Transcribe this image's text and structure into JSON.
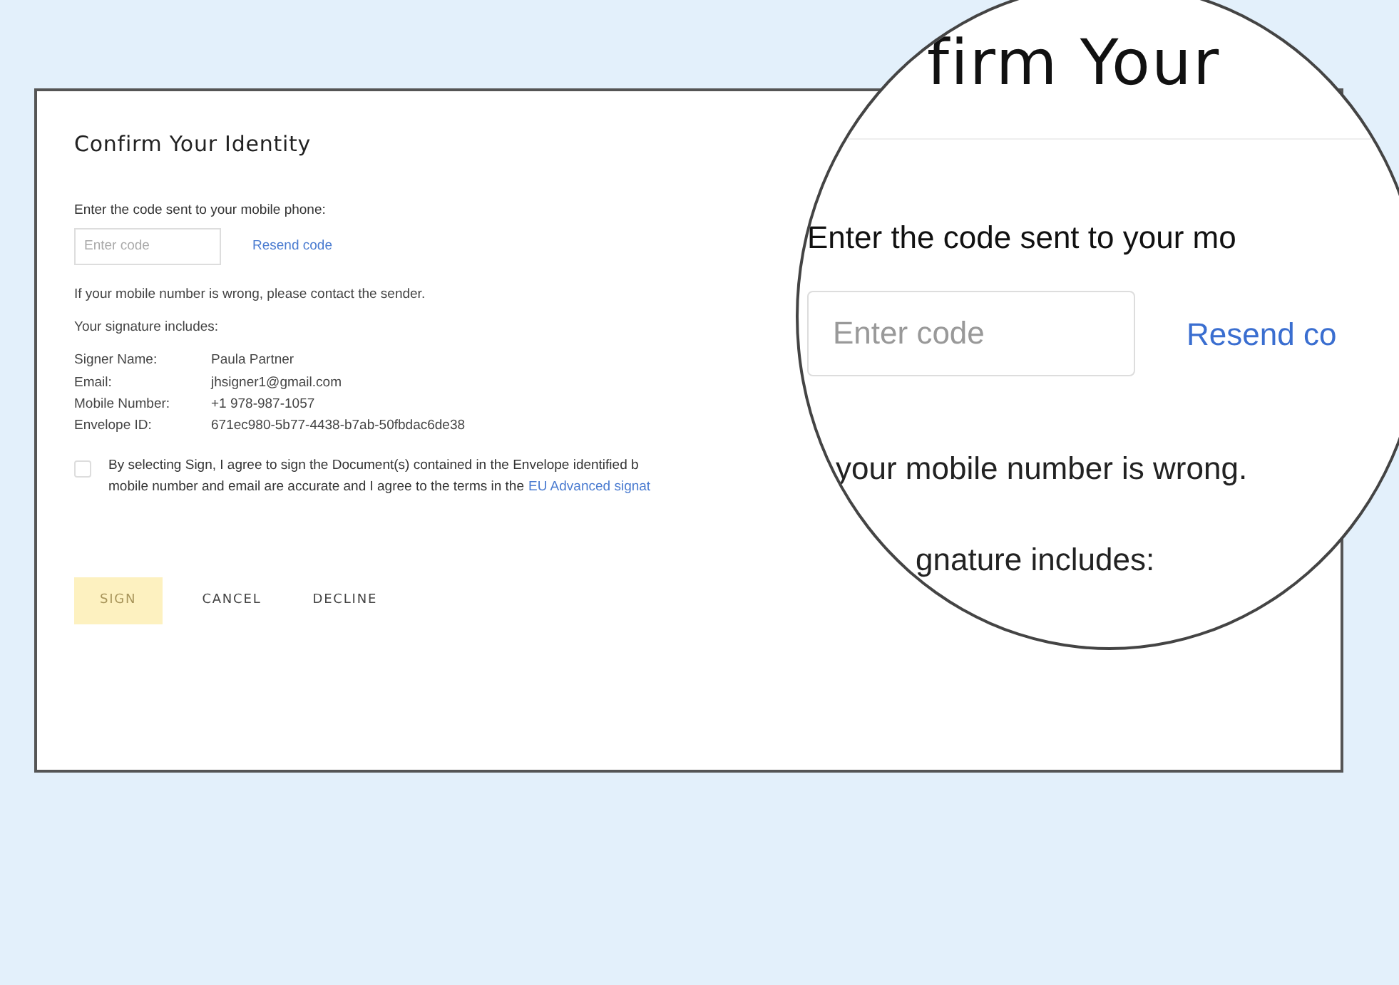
{
  "dialog": {
    "title": "Confirm Your Identity",
    "code_prompt": "Enter the code sent to your mobile phone:",
    "code_field": {
      "placeholder": "Enter code"
    },
    "resend_link": "Resend code",
    "wrong_number_note": "If your mobile number is wrong, please contact the sender.",
    "signature_heading": "Your signature includes:",
    "details": [
      {
        "label": "Signer Name:",
        "value": "Paula Partner"
      },
      {
        "label": "Email:",
        "value": "jhsigner1@gmail.com"
      },
      {
        "label": "Mobile Number:",
        "value": "+1 978-987-1057"
      },
      {
        "label": "Envelope ID:",
        "value": "671ec980-5b77-4438-b7ab-50fbdac6de38"
      }
    ],
    "consent": {
      "checked": false,
      "line_1": "By selecting Sign, I agree to sign the Document(s) contained in the Envelope identified b",
      "line_2": "mobile number and email are accurate and I agree to the terms in the",
      "link": "EU Advanced signat"
    },
    "buttons": [
      {
        "label": "SIGN",
        "disabled": true,
        "kind": "primary"
      },
      {
        "label": "CANCEL",
        "disabled": false,
        "kind": "text"
      },
      {
        "label": "DECLINE",
        "disabled": false,
        "kind": "text"
      }
    ]
  },
  "magnifier": {
    "title": "firm Your",
    "code_prompt": "Enter the code sent to your mo",
    "code_field": {
      "placeholder": "Enter code"
    },
    "resend_link": "Resend co",
    "wrong_number_note": "your mobile number is wrong.",
    "signature_heading": "gnature includes:"
  }
}
